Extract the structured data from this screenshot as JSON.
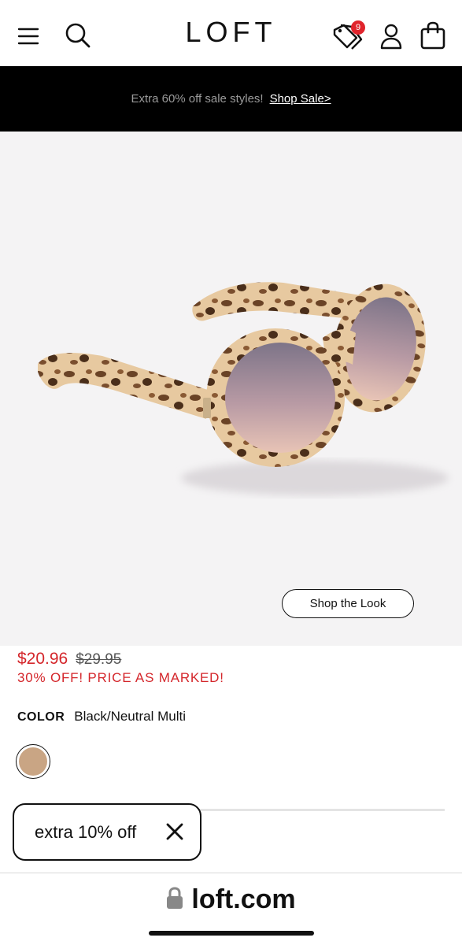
{
  "header": {
    "logo": "LOFT",
    "offers_badge_count": "9",
    "icons": [
      "menu-icon",
      "search-icon",
      "offers-tag-icon",
      "account-icon",
      "shopping-bag-icon"
    ]
  },
  "promo_bar": {
    "text": "Extra 60% off sale styles!",
    "link": "Shop Sale>"
  },
  "product": {
    "shop_the_look": "Shop the Look",
    "sale_price": "$20.96",
    "original_price": "$29.95",
    "promo_note": "30% OFF! PRICE AS MARKED!",
    "color_label": "COLOR",
    "color_value": "Black/Neutral Multi",
    "swatch_color": "#c9a584"
  },
  "toast": {
    "text": "extra 10% off"
  },
  "browser": {
    "url": "loft.com"
  },
  "colors": {
    "sale_red": "#d4262b",
    "badge_red": "#e0242c",
    "promo_bg": "#000000",
    "image_bg": "#f4f3f4"
  }
}
